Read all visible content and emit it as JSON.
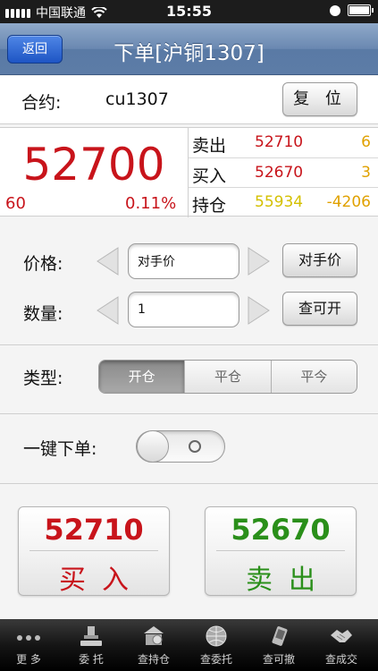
{
  "status_bar": {
    "carrier": "中国联通",
    "time": "15:55"
  },
  "nav": {
    "back_label": "返回",
    "title": "下单[沪铜1307]"
  },
  "contract": {
    "label": "合约:",
    "code": "cu1307",
    "reset_label": "复 位"
  },
  "quote": {
    "last_price": "52700",
    "change": "60",
    "change_pct": "0.11%",
    "rows": [
      {
        "key": "卖出",
        "price": "52710",
        "volume": "6"
      },
      {
        "key": "买入",
        "price": "52670",
        "volume": "3"
      },
      {
        "key": "持仓",
        "price": "55934",
        "volume": "-4206"
      }
    ]
  },
  "form": {
    "price_label": "价格:",
    "price_value": "对手价",
    "price_button": "对手价",
    "qty_label": "数量:",
    "qty_value": "1",
    "qty_button": "查可开"
  },
  "order_type": {
    "label": "类型:",
    "options": [
      "开仓",
      "平仓",
      "平今"
    ],
    "selected": "开仓"
  },
  "one_key": {
    "label": "一键下单:",
    "enabled": false
  },
  "trade": {
    "buy_price": "52710",
    "buy_label": "买入",
    "sell_price": "52670",
    "sell_label": "卖出"
  },
  "tabs": [
    {
      "label": "更 多",
      "icon": "more-icon"
    },
    {
      "label": "委 托",
      "icon": "gavel-icon"
    },
    {
      "label": "查持仓",
      "icon": "building-icon"
    },
    {
      "label": "查委托",
      "icon": "globe-icon"
    },
    {
      "label": "查可撤",
      "icon": "phone-icon"
    },
    {
      "label": "查成交",
      "icon": "handshake-icon"
    }
  ],
  "colors": {
    "red": "#c8141b",
    "green": "#2a8f1a",
    "yellow": "#d4c000",
    "orange": "#e0a100",
    "nav_blue": "#6a88b1"
  }
}
